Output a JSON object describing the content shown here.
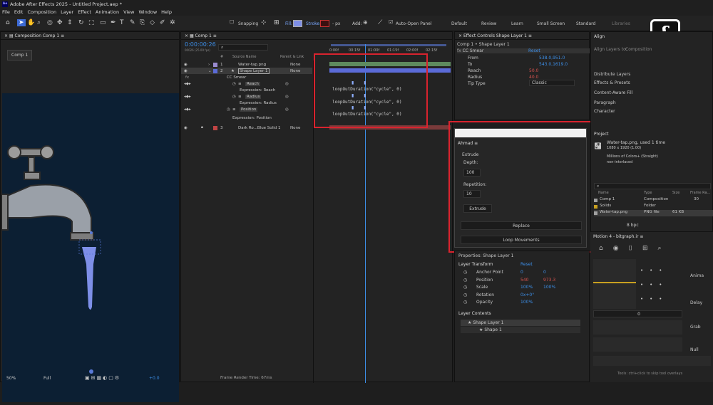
{
  "app": {
    "title": "Adobe After Effects 2025 - Untitled Project.aep *",
    "icon": "Ae"
  },
  "menu": [
    "File",
    "Edit",
    "Composition",
    "Layer",
    "Effect",
    "Animation",
    "View",
    "Window",
    "Help"
  ],
  "toolbar": {
    "snapping": "Snapping",
    "fill": "Fill:",
    "stroke": "Stroke:",
    "stroke_px": "- px",
    "add": "Add:",
    "auto_open": "Auto-Open Panel"
  },
  "workspaces": [
    "Default",
    "Review",
    "Learn",
    "Small Screen",
    "Standard",
    "Libraries"
  ],
  "comp_panel": {
    "title": "Composition Comp 1",
    "tab": "Comp 1",
    "zoom": "50%",
    "quality": "Full",
    "exposure": "+0.0"
  },
  "timeline": {
    "tab": "Comp 1",
    "timecode": "0:00:00:26",
    "fps": "00026 (25.00 fps)",
    "search_placeholder": "⌕",
    "cols": {
      "num": "#",
      "source": "Source Name",
      "parent": "Parent & Link"
    },
    "ruler": [
      "0:00f",
      "00:15f",
      "01:00f",
      "01:15f",
      "02:00f",
      "02:15f"
    ],
    "layers": [
      {
        "num": "1",
        "name": "Water-tap.png",
        "parent": "None",
        "color": "#9a8bcf"
      },
      {
        "num": "2",
        "name": "Shape Layer 1",
        "parent": "None",
        "color": "#5b6bd8"
      },
      {
        "num": "3",
        "name": "Dark Ro...Blue Solid 1",
        "parent": "None",
        "color": "#c04444"
      }
    ],
    "effect": "CC Smear",
    "props": [
      {
        "name": "Reach",
        "expr": "Expression: Reach"
      },
      {
        "name": "Radius",
        "expr": "Expression: Radius"
      },
      {
        "name": "Position",
        "expr": "Expression: Position"
      }
    ],
    "code": "loopOutDuration(\"cycle\", 0)",
    "footer": "Frame Render Time: 67ms"
  },
  "effect_controls": {
    "tab": "Effect Controls Shape Layer 1",
    "subtitle": "Comp 1 • Shape Layer 1",
    "effect": "CC Smear",
    "reset": "Reset",
    "rows": [
      {
        "label": "From",
        "value": "538.0,951.0"
      },
      {
        "label": "To",
        "value": "543.0,1619.0"
      },
      {
        "label": "Reach",
        "value": "50.0"
      },
      {
        "label": "Radius",
        "value": "40.0"
      },
      {
        "label": "Tip Type",
        "value": "Classic"
      }
    ]
  },
  "ahmad": {
    "tab": "Ahmad",
    "section": "Extrude",
    "depth_label": "Depth:",
    "depth": "100",
    "repetition_label": "Repetition:",
    "repetition": "10",
    "extrude_btn": "Extrude",
    "replace_btn": "Replace",
    "loop_btn": "Loop Movements"
  },
  "properties": {
    "title": "Properties: Shape Layer 1",
    "transform": "Layer Transform",
    "reset": "Reset",
    "rows": [
      {
        "label": "Anchor Point",
        "v1": "0",
        "v2": "0"
      },
      {
        "label": "Position",
        "v1": "540",
        "v2": "973.3"
      },
      {
        "label": "Scale",
        "v1": "100%",
        "v2": "100%"
      },
      {
        "label": "Rotation",
        "v1": "0x+0°",
        "v2": ""
      },
      {
        "label": "Opacity",
        "v1": "100%",
        "v2": ""
      }
    ],
    "contents": "Layer Contents",
    "items": [
      "Shape Layer 1",
      "Shape 1"
    ]
  },
  "right": {
    "align": "Align",
    "align_to": "Align Layers to:",
    "composition": "Composition",
    "sections": [
      "Distribute Layers",
      "Effects & Presets",
      "Content-Aware Fill",
      "Paragraph",
      "Character"
    ],
    "project": "Project",
    "thumb_name": "Water-tap.png",
    "thumb_used": ", used 1 time",
    "thumb_size": "1080 x 1920 (1.00)",
    "thumb_colors": "Millions of Colors+ (Straight)",
    "thumb_interlace": "non-interlaced",
    "cols": [
      "Name",
      "Type",
      "Size",
      "Frame Ra..."
    ],
    "items": [
      {
        "name": "Comp 1",
        "type": "Composition",
        "size": "",
        "rate": "30"
      },
      {
        "name": "Solids",
        "type": "Folder",
        "size": "",
        "rate": ""
      },
      {
        "name": "Water-tap.png",
        "type": "PNG file",
        "size": "61 KB",
        "rate": ""
      }
    ],
    "bpc": "8 bpc"
  },
  "motion": {
    "title": "Motion 4 - bitgraph.ir",
    "labels": [
      "Anima",
      "Delay",
      "Grab",
      "Null"
    ],
    "hint": "Tools: ctrl+click to skip tool overlays",
    "value": "0"
  }
}
